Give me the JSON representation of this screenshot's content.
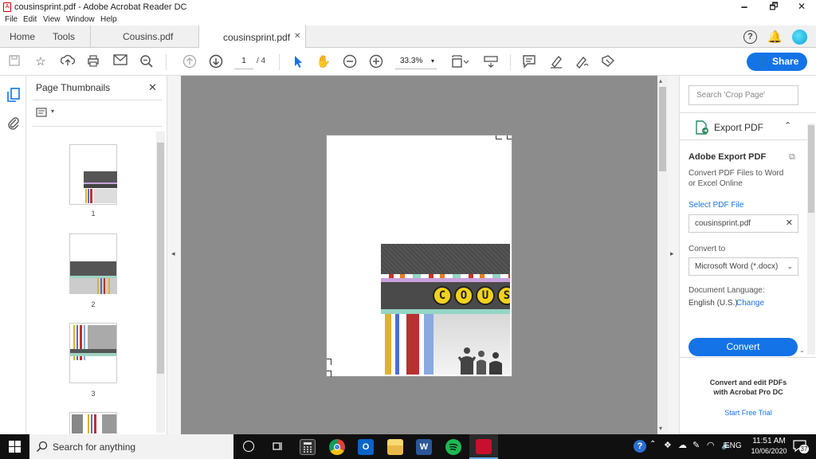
{
  "window": {
    "title": "cousinsprint.pdf - Adobe Acrobat Reader DC",
    "minimize": "🗕",
    "restore": "🗗",
    "close": "✕"
  },
  "menu": {
    "items": [
      "File",
      "Edit",
      "View",
      "Window",
      "Help"
    ]
  },
  "tabs": {
    "home": "Home",
    "tools": "Tools",
    "doc1": "Cousins.pdf",
    "doc2": "cousinsprint.pdf",
    "close": "✕"
  },
  "toolbar": {
    "page_current": "1",
    "page_total": "/ 4",
    "zoom": "33.3%",
    "share_label": "Share"
  },
  "thumbnails": {
    "title": "Page Thumbnails",
    "close": "✕",
    "pages": [
      "1",
      "2",
      "3"
    ]
  },
  "right_panel": {
    "search_placeholder": "Search 'Crop Page'",
    "export_header": "Export PDF",
    "export_title": "Adobe Export PDF",
    "export_desc_1": "Convert PDF Files to Word",
    "export_desc_2": "or Excel Online",
    "select_file_label": "Select PDF File",
    "selected_file": "cousinsprint.pdf",
    "convert_to_label": "Convert to",
    "convert_to_value": "Microsoft Word (*.docx)",
    "doc_lang_label": "Document Language:",
    "doc_lang_value": "English (U.S.)",
    "change_link": "Change",
    "convert_button": "Convert",
    "promo_1": "Convert and edit PDFs",
    "promo_2": "with Acrobat Pro DC",
    "trial_link": "Start Free Trial"
  },
  "document": {
    "banner_letters": [
      "C",
      "O",
      "U",
      "S"
    ]
  },
  "taskbar": {
    "search_placeholder": "Search for anything",
    "lang": "ENG",
    "time": "11:51 AM",
    "date": "10/06/2020",
    "notif_count": "37"
  },
  "colors": {
    "accent": "#1473e6",
    "doc_background": "#8c8c8c",
    "taskbar": "#101010"
  }
}
